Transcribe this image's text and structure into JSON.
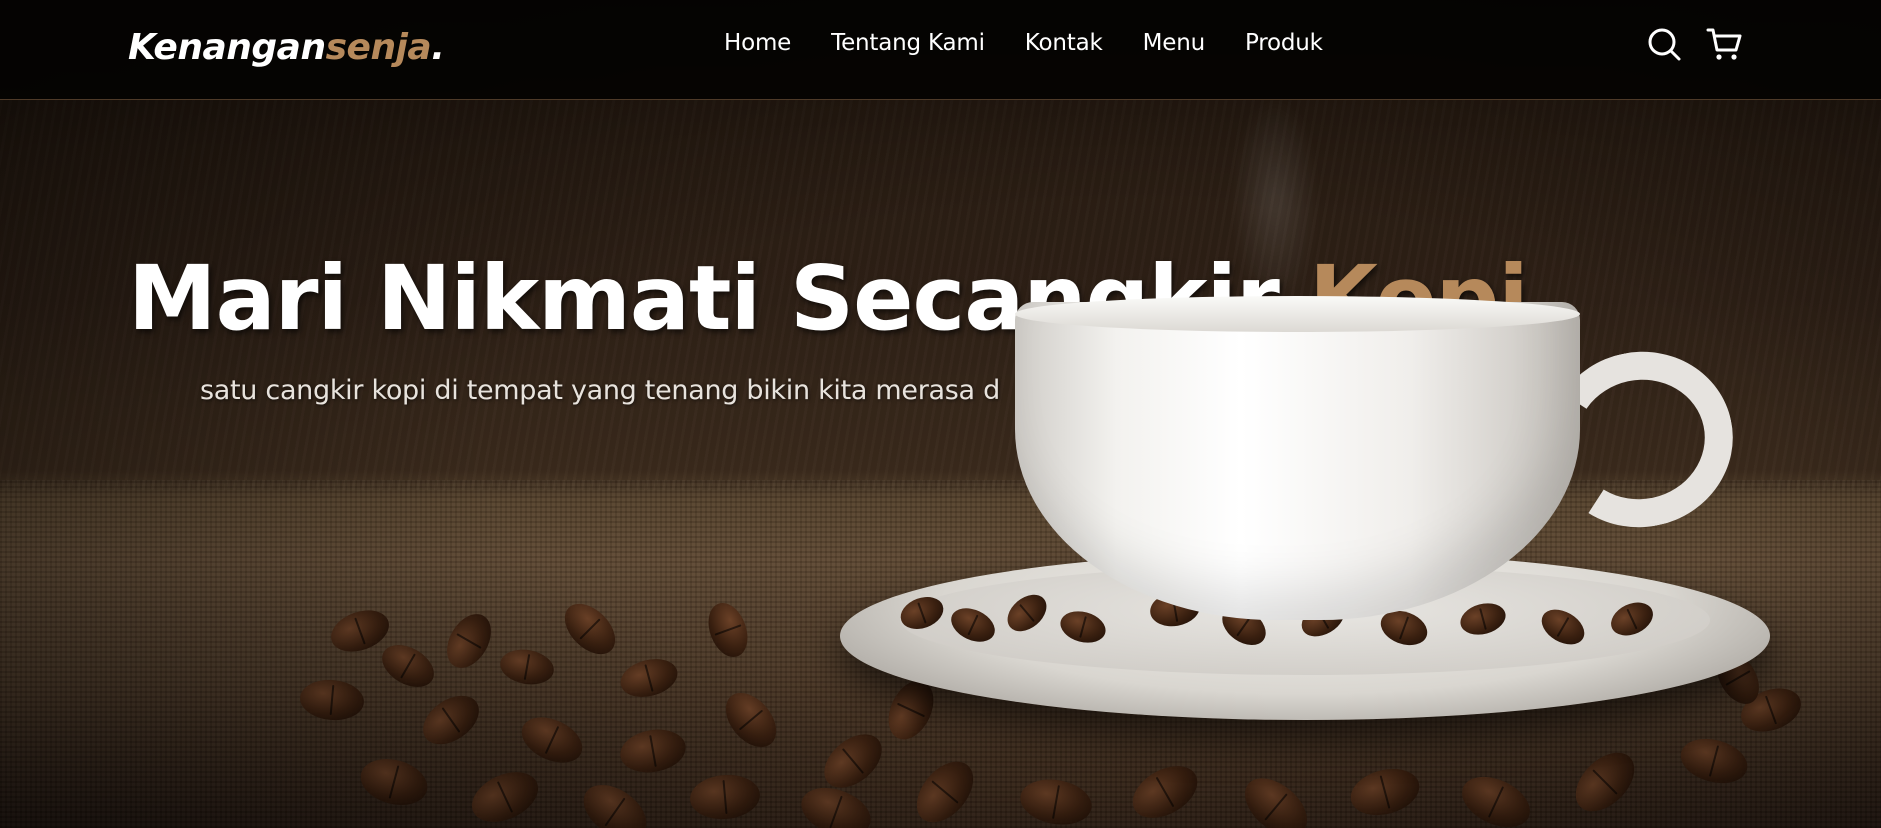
{
  "brand": {
    "name_main": "Kenangan",
    "name_accent": "senja",
    "name_dot": ".",
    "accent_color": "#b6895b"
  },
  "nav": {
    "links": [
      "Home",
      "Tentang Kami",
      "Kontak",
      "Menu",
      "Produk"
    ],
    "icons": [
      "search-icon",
      "shopping-cart-icon"
    ]
  },
  "hero": {
    "title_main": "Mari Nikmati Secangkir ",
    "title_accent": "Kopi",
    "subtitle": "satu cangkir kopi di tempat yang tenang bikin kita merasa d"
  }
}
